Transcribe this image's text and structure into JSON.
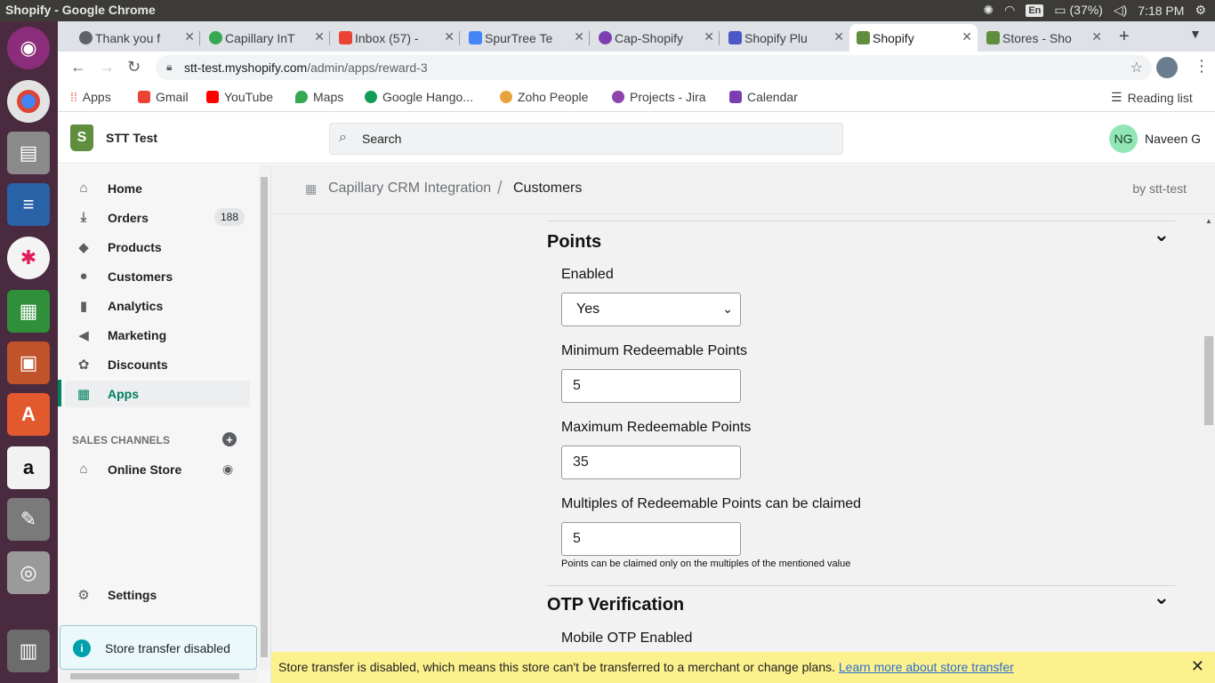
{
  "os": {
    "window_title": "Shopify - Google Chrome",
    "lang": "En",
    "battery": "(37%)",
    "time": "7:18 PM"
  },
  "tabs": [
    {
      "label": "Thank you f",
      "color": "#5f6368"
    },
    {
      "label": "Capillary InT",
      "color": "#34a853"
    },
    {
      "label": "Inbox (57) - ",
      "color": "#ea4335"
    },
    {
      "label": "SpurTree Te",
      "color": "#4285f4"
    },
    {
      "label": "Cap-Shopify",
      "color": "#7b3fb1"
    },
    {
      "label": "Shopify Plu",
      "color": "#4b57c4"
    },
    {
      "label": "Shopify",
      "color": "#5e8e3e"
    },
    {
      "label": "Stores - Sho",
      "color": "#5e8e3e"
    }
  ],
  "address": {
    "host": "stt-test.myshopify.com",
    "path": "/admin/apps/reward-3"
  },
  "bookmarks": [
    {
      "label": "Apps",
      "color": "#ea4335"
    },
    {
      "label": "Gmail",
      "color": "#ea4335"
    },
    {
      "label": "YouTube",
      "color": "#ff0000"
    },
    {
      "label": "Maps",
      "color": "#34a853"
    },
    {
      "label": "Google Hango...",
      "color": "#0f9d58"
    },
    {
      "label": "Zoho People",
      "color": "#e8a33d"
    },
    {
      "label": "Projects - Jira",
      "color": "#8e44ad"
    },
    {
      "label": "Calendar",
      "color": "#7b3fb1"
    }
  ],
  "reading_list": "Reading list",
  "shop": {
    "store_name": "STT Test",
    "search_placeholder": "Search",
    "user_initials": "NG",
    "user_name": "Naveen G"
  },
  "nav": {
    "items": [
      {
        "label": "Home",
        "icon": "home-icon",
        "glyph": "⌂"
      },
      {
        "label": "Orders",
        "icon": "orders-icon",
        "glyph": "⤓",
        "badge": "188"
      },
      {
        "label": "Products",
        "icon": "tag-icon",
        "glyph": "◆"
      },
      {
        "label": "Customers",
        "icon": "person-icon",
        "glyph": "●"
      },
      {
        "label": "Analytics",
        "icon": "bar-chart-icon",
        "glyph": "▮"
      },
      {
        "label": "Marketing",
        "icon": "megaphone-icon",
        "glyph": "◀"
      },
      {
        "label": "Discounts",
        "icon": "discount-icon",
        "glyph": "✿"
      },
      {
        "label": "Apps",
        "icon": "apps-icon",
        "glyph": "▦"
      }
    ],
    "sales_channels_label": "SALES CHANNELS",
    "online_store": "Online Store",
    "settings": "Settings",
    "store_transfer": "Store transfer disabled"
  },
  "breadcrumb": {
    "app": "Capillary CRM Integration",
    "page": "Customers",
    "by": "by stt-test"
  },
  "points": {
    "title": "Points",
    "enabled_label": "Enabled",
    "enabled_value": "Yes",
    "min_label": "Minimum Redeemable Points",
    "min_value": "5",
    "max_label": "Maximum Redeemable Points",
    "max_value": "35",
    "multiples_label": "Multiples of Redeemable Points can be claimed",
    "multiples_value": "5",
    "multiples_help": "Points can be claimed only on the multiples of the mentioned value"
  },
  "otp": {
    "title": "OTP Verification",
    "mobile_label": "Mobile OTP Enabled"
  },
  "banner": {
    "message": "Store transfer is disabled, which means this store can't be transferred to a merchant or change plans.",
    "link": "Learn more about store transfer"
  }
}
